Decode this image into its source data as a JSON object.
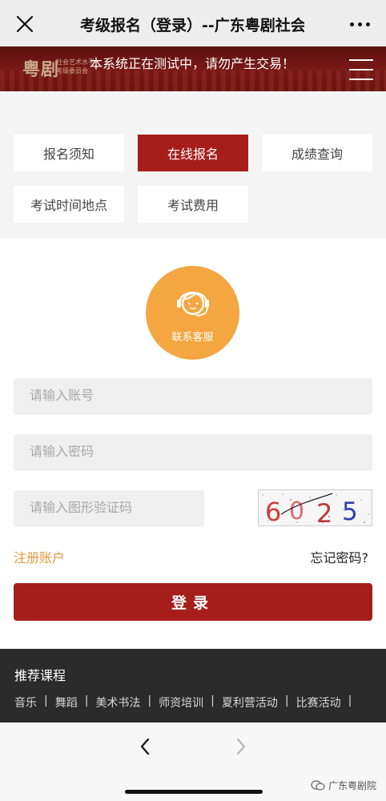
{
  "navbar": {
    "title": "考级报名（登录）--广东粤剧社会",
    "close_icon": "close-icon",
    "more_icon": "more-icon"
  },
  "banner": {
    "logo_text": "粤剧",
    "logo_sub": "社会艺术水平考级委员会",
    "notice": "本系统正在测试中，请勿产生交易！",
    "menu_icon": "menu-icon"
  },
  "tabs": [
    {
      "label": "报名须知"
    },
    {
      "label": "在线报名"
    },
    {
      "label": "成绩查询"
    },
    {
      "label": "考试时间地点"
    },
    {
      "label": "考试费用"
    }
  ],
  "service": {
    "label": "联系客服",
    "icon": "customer-service-icon"
  },
  "form": {
    "account_placeholder": "请输入账号",
    "password_placeholder": "请输入密码",
    "captcha_placeholder": "请输入图形验证码",
    "captcha_text": "6025",
    "register_label": "注册账户",
    "forgot_label": "忘记密码?",
    "login_label": "登录"
  },
  "courses": {
    "title": "推荐课程",
    "items": [
      "音乐",
      "舞蹈",
      "美术书法",
      "师资培训",
      "夏利营活动",
      "比赛活动"
    ]
  },
  "bottombar": {
    "back_icon": "chevron-left-icon",
    "forward_icon": "chevron-right-icon",
    "watermark": "广东粤剧院"
  },
  "colors": {
    "brand_red": "#a61e1a",
    "service_orange": "#f4a640",
    "register_link": "#e39a3b"
  }
}
